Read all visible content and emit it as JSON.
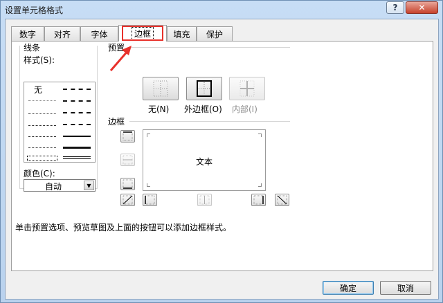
{
  "window": {
    "title": "设置单元格格式",
    "help_label": "?",
    "close_label": "✕"
  },
  "tabs": [
    {
      "label": "数字"
    },
    {
      "label": "对齐"
    },
    {
      "label": "字体"
    },
    {
      "label": "边框"
    },
    {
      "label": "填充"
    },
    {
      "label": "保护"
    }
  ],
  "active_tab": "边框",
  "line_group": {
    "title": "线条",
    "style_label": "样式(S):",
    "style_none": "无",
    "color_label": "颜色(C):",
    "color_value": "自动"
  },
  "preset_group": {
    "title": "预置",
    "buttons": [
      {
        "label": "无(N)"
      },
      {
        "label": "外边框(O)"
      },
      {
        "label": "内部(I)"
      }
    ]
  },
  "border_group": {
    "title": "边框",
    "preview_text": "文本"
  },
  "instruction": "单击预置选项、预览草图及上面的按钮可以添加边框样式。",
  "footer": {
    "ok_label": "确定",
    "cancel_label": "取消"
  },
  "colors": {
    "highlight": "#e8312b",
    "client_bg": "#f0f0f0",
    "panel_bg": "#ffffff"
  }
}
